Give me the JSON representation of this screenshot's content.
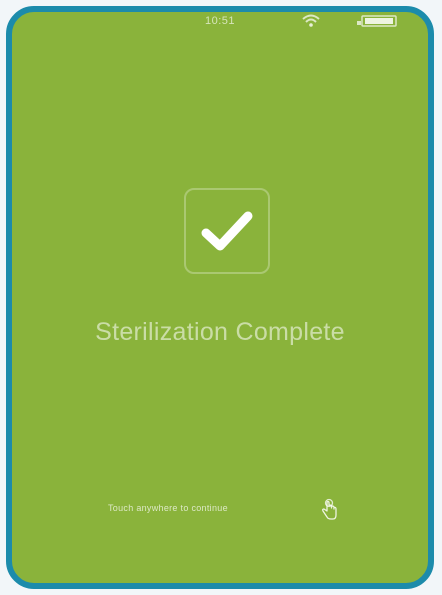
{
  "status_bar": {
    "time": "10:51",
    "wifi_icon": "wifi-icon",
    "battery_icon": "battery-icon"
  },
  "main": {
    "check_icon": "checkmark-icon",
    "title": "Sterilization Complete",
    "prompt": "Touch anywhere to continue",
    "touch_icon": "hand-touch-icon"
  },
  "colors": {
    "background": "#8ab33b",
    "frame": "#1c8bab",
    "text": "#ffffff"
  }
}
